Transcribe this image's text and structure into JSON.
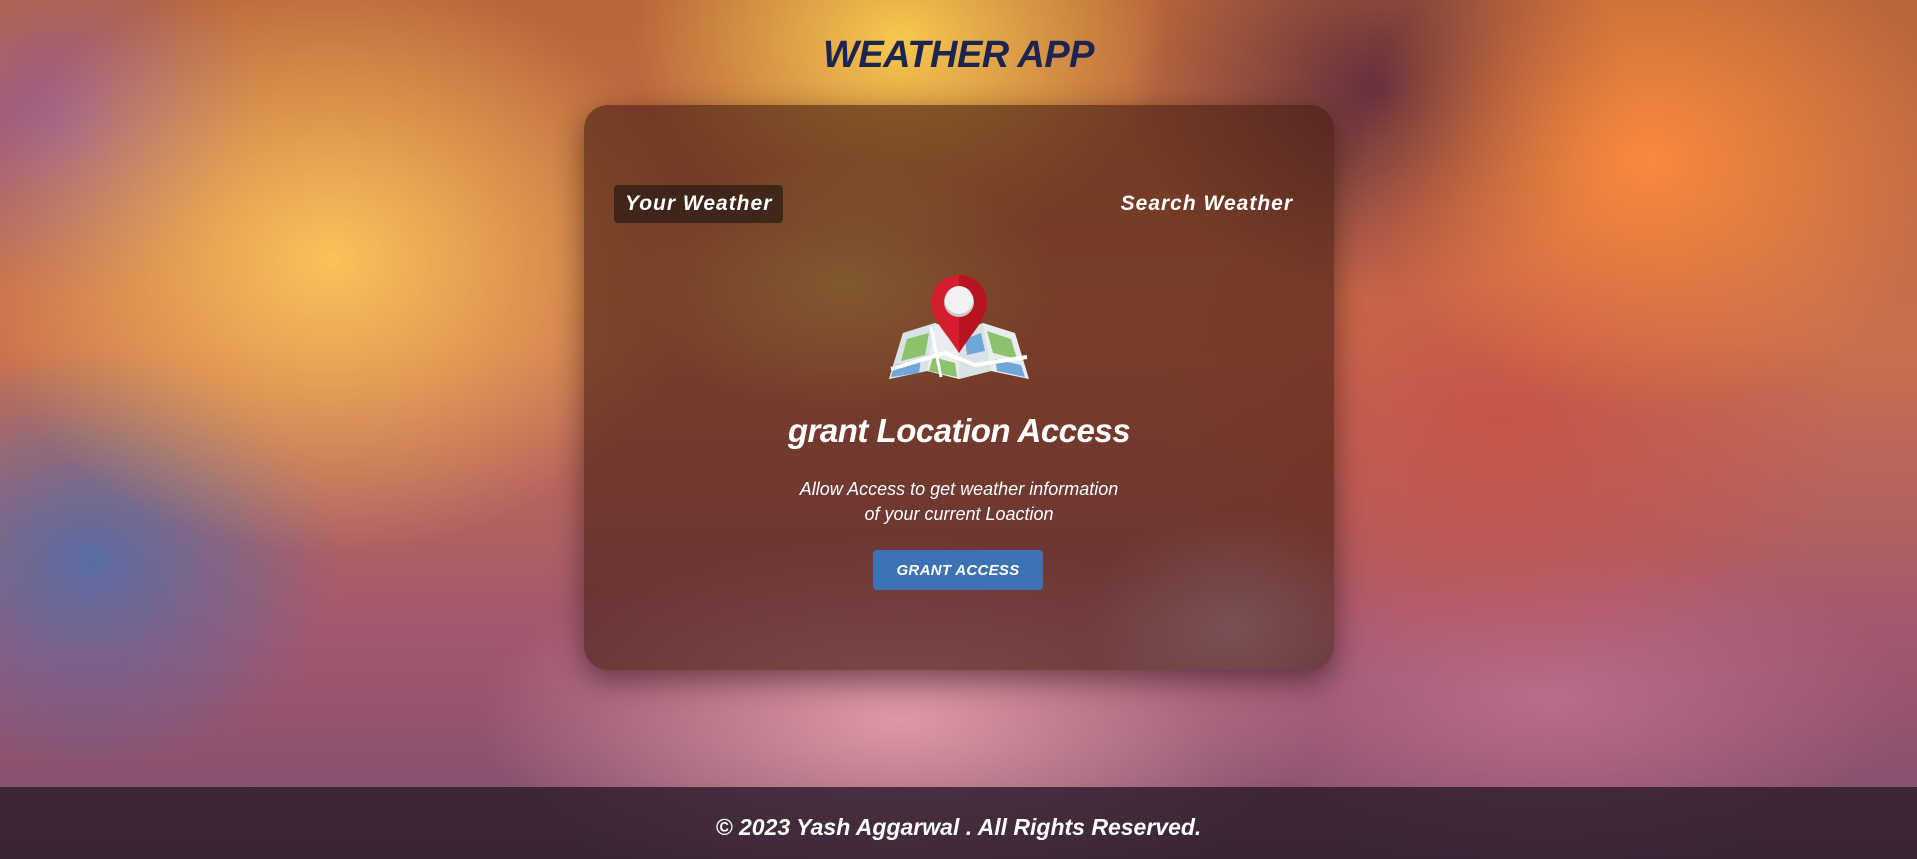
{
  "app": {
    "title": "WEATHER APP"
  },
  "tabs": [
    {
      "label": "Your Weather",
      "active": true
    },
    {
      "label": "Search Weather",
      "active": false
    }
  ],
  "grant_location": {
    "icon": "map-pin-icon",
    "heading": "grant Location Access",
    "description_line1": "Allow Access to get weather information",
    "description_line2": "of your current Loaction",
    "button_label": "GRANT ACCESS"
  },
  "footer": {
    "text": "© 2023 Yash Aggarwal . All Rights Reserved."
  },
  "colors": {
    "title": "#1c2550",
    "button": "#3d72b4",
    "pin": "#d41e2e"
  }
}
